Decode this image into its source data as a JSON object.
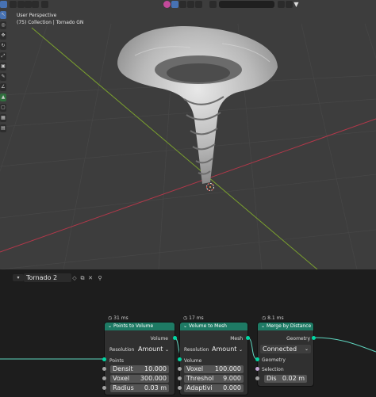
{
  "viewport": {
    "overlay_line1": "User Perspective",
    "overlay_line2": "(75) Collection | Tornado GN",
    "tool_icons": [
      "cursor-icon",
      "select-box-icon",
      "move-icon",
      "rotate-icon",
      "scale-icon",
      "transform-icon",
      "annotate-icon",
      "measure-icon",
      "add-cube-icon",
      "camera-icon",
      "grid-icon",
      "box-icon"
    ],
    "colors": {
      "background": "#3d3d3d",
      "x_axis": "#b3384a",
      "y_axis": "#7ba12e",
      "accent": "#4772b3"
    }
  },
  "node_editor": {
    "tree_name": "Tornado 2",
    "nodes": [
      {
        "title": "Points to Volume",
        "timing": "31 ms",
        "output_label": "Volume",
        "resolution_label": "Resolution",
        "resolution_value": "Amount",
        "input_label": "Points",
        "fields": [
          {
            "label": "Densit",
            "value": "10.000"
          },
          {
            "label": "Voxel",
            "value": "300.000"
          },
          {
            "label": "Radius",
            "value": "0.03 m"
          }
        ]
      },
      {
        "title": "Volume to Mesh",
        "timing": "17 ms",
        "output_label": "Mesh",
        "resolution_label": "Resolution",
        "resolution_value": "Amount",
        "input_label": "Volume",
        "fields": [
          {
            "label": "Voxel",
            "value": "100.000"
          },
          {
            "label": "Threshol",
            "value": "9.000"
          },
          {
            "label": "Adaptivi",
            "value": "0.000"
          }
        ]
      },
      {
        "title": "Merge by Distance",
        "timing": "8.1 ms",
        "output_label": "Geometry",
        "mode_value": "Connected",
        "input_geometry": "Geometry",
        "input_selection": "Selection",
        "fields": [
          {
            "label": "Dis",
            "value": "0.02 m"
          }
        ]
      }
    ],
    "colors": {
      "header": "#1e7a64",
      "geometry_socket": "#00d6a3",
      "link": "#5fd6c0"
    }
  }
}
